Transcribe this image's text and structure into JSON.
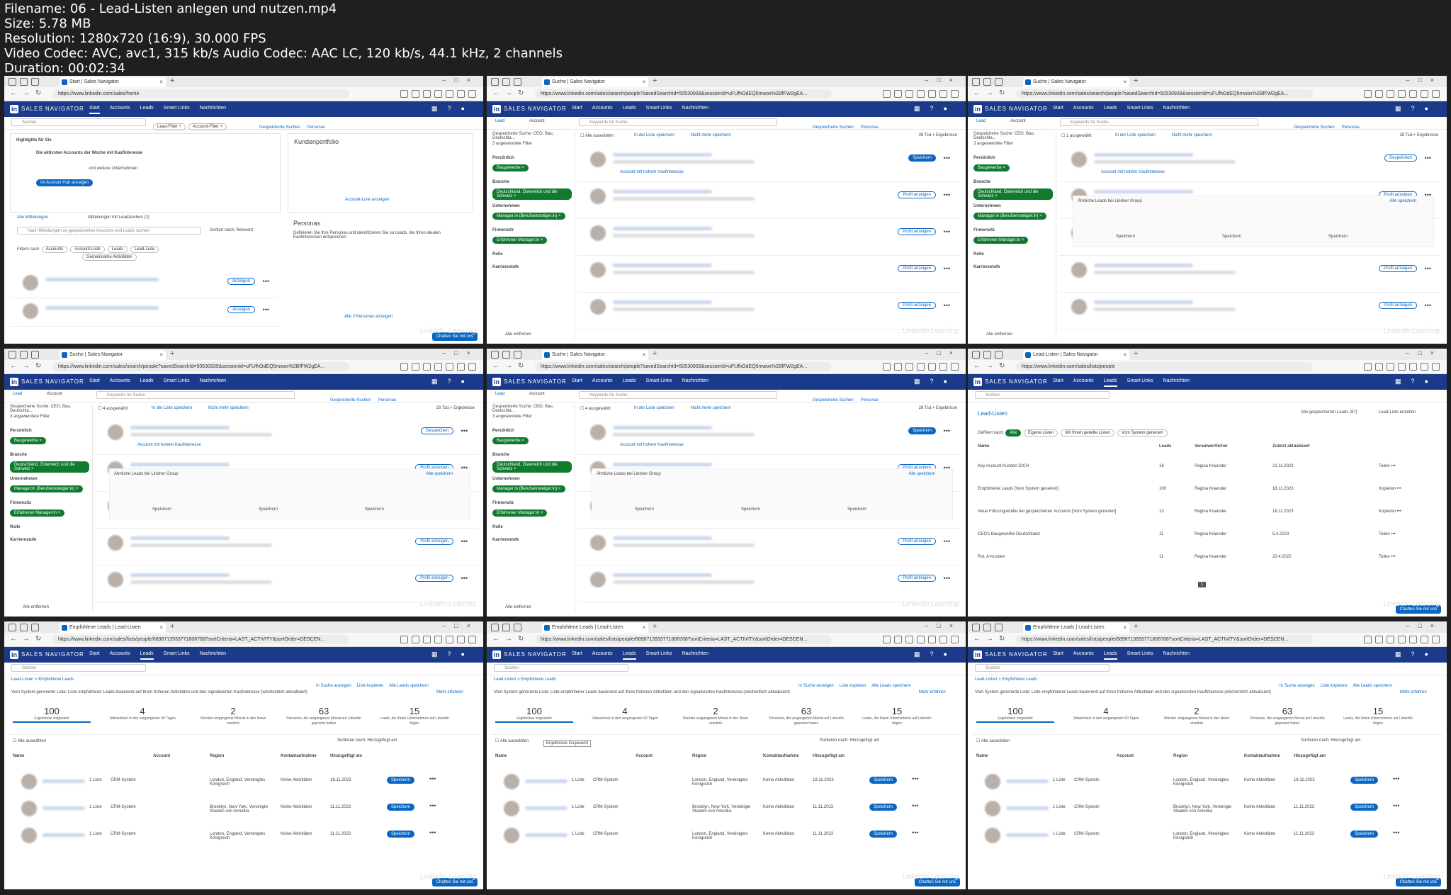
{
  "header": {
    "filename": "Filename: 06 - Lead-Listen anlegen und nutzen.mp4",
    "size": "Size: 5.78 MB",
    "resolution": "Resolution: 1280x720 (16:9), 30.000 FPS",
    "codec": "Video Codec: AVC, avc1, 315 kb/s Audio Codec: AAC LC, 120 kb/s, 44.1 kHz, 2 channels",
    "duration": "Duration: 00:02:34"
  },
  "nav": {
    "brand": "SALES NAVIGATOR",
    "items": [
      "Start",
      "Accounts",
      "Leads",
      "Smart Links",
      "Nachrichten"
    ]
  },
  "tiles": [
    {
      "tab": "Start | Sales Navigator",
      "url": "https://www.linkedin.com/sales/home",
      "active_nav": "Start",
      "kind": "home",
      "search_placeholder": "Suchen",
      "filters": [
        "Lead-Filter +",
        "Account-Filter +"
      ],
      "links": [
        "Gespeicherte Suchen",
        "Personas"
      ],
      "highlights": "Highlights für Sie",
      "highlight_text": "Die aktivsten Accounts der Woche mit Kaufinteresse",
      "highlight_more": "und weitere Unternehmen",
      "hub_button": "Im Account Hub anzeigen",
      "tab_all": "Alle Mitteilungen",
      "tab_leads": "Mitteilungen mit Leadzeichen (2)",
      "search_msgs": "Nach Mitteilungen zu gespeicherten Accounts und Leads suchen",
      "sort": "Sortiert nach: Relevant",
      "filter_by": "Filtern nach:",
      "filter_pills": [
        "Accounts",
        "Account-Liste",
        "Leads",
        "Lead-Liste"
      ],
      "common": "Gemeinsame Aktivitäten",
      "portfolio_title": "Kundenportfolio",
      "portfolio_link": "Account-Liste anzeigen",
      "personas_title": "Personas",
      "personas_text": "Definieren Sie Ihre Personas und identifizieren Sie so Leads, die Ihren idealen Kaufinteressen entsprechen",
      "show": "Anzeigen",
      "all_personas": "Alle 2 Personas anzeigen",
      "chat": "Chatten Sie mit uns"
    },
    {
      "tab": "Suche | Sales Navigator",
      "url": "https://www.linkedin.com/sales/search/people?savedSearchId=50530939&sessionId=uFUfhOdEQ5mwox%2BfFW2gEA...",
      "active_nav": "",
      "kind": "search",
      "saved_search": "Gespeicherte Suche: CEO, Bau, Deutschla...",
      "filters_applied": "3 angewendete Filter",
      "labels": [
        "Persönlich",
        "Branche",
        "Unternehmen",
        "Firmensitz",
        "Rolle",
        "Karrierestufe"
      ],
      "tags": [
        "Baugewerbe",
        "Deutschland, Österreich und die Schweiz",
        "Manager:in (Berufseinsteiger:in)",
        "Erfahrener Manager:in"
      ],
      "keyword_placeholder": "Keywords für Suche",
      "links": [
        "Gespeicherte Suchen",
        "Personas"
      ],
      "select_all": "Alle auswählen",
      "in_list": "In der Liste speichern",
      "no_more": "Nicht mehr speichern",
      "count": "28 Tsd.+ Ergebnisse",
      "save": "Speichern",
      "profile": "Profil anzeigen",
      "account_interest": "Account mit hohem Kaufinteresse",
      "remove_all": "Alle entfernen",
      "tab_lead": "Lead",
      "tab_account": "Account"
    },
    {
      "tab": "Suche | Sales Navigator",
      "url": "https://www.linkedin.com/sales/search/people?savedSearchId=50530939&sessionId=uFUfhOdEQ5mwox%2BfFW2gEA...",
      "active_nav": "",
      "kind": "search",
      "saved_search": "Gespeicherte Suche: CEO, Bau, Deutschla...",
      "selected": "1 ausgewählt",
      "in_list": "In der Liste speichern",
      "no_more": "Nicht mehr speichern",
      "count": "28 Tsd.+ Ergebnisse",
      "saved": "Gespeichert",
      "similar": "Ähnliche Leads bei Lindner Group",
      "all_save": "Alle speichern",
      "save": "Speichern",
      "profile": "Profil anzeigen"
    },
    {
      "tab": "Suche | Sales Navigator",
      "url": "https://www.linkedin.com/sales/search/people?savedSearchId=50530939&sessionId=uFUfhOdEQ5mwox%2BfFW2gEA...",
      "active_nav": "",
      "kind": "search",
      "saved_search": "Gespeicherte Suche: CEO, Bau, Deutschla...",
      "selected": "4 ausgewählt",
      "in_list": "In der Liste speichern",
      "no_more": "Nicht mehr speichern",
      "count": "28 Tsd.+ Ergebnisse",
      "saved": "Gespeichert",
      "similar": "Ähnliche Leads bei Lindner Group",
      "all_save": "Alle speichern",
      "save": "Speichern",
      "profile": "Profil anzeigen"
    },
    {
      "tab": "Suche | Sales Navigator",
      "url": "https://www.linkedin.com/sales/search/people?savedSearchId=50530939&sessionId=uFUfhOdEQ5mwox%2BfFW2gEA...",
      "active_nav": "",
      "kind": "search",
      "saved_search": "Gespeicherte Suche: CEO, Bau, Deutschla...",
      "selected": "4 ausgewählt",
      "in_list": "In der Liste speichern",
      "no_more": "Nicht mehr speichern",
      "count": "28 Tsd.+ Ergebnisse",
      "similar": "Ähnliche Leads bei Lindner Group",
      "all_save": "Alle speichern",
      "save": "Speichern",
      "profile": "Profil anzeigen"
    },
    {
      "tab": "Lead-Listen | Sales Navigator",
      "url": "https://www.linkedin.com/sales/lists/people",
      "active_nav": "Leads",
      "kind": "lists",
      "heading": "Lead-Listen",
      "all_saved": "Alle gespeicherten Leads (87)",
      "create": "Lead-Liste erstellen",
      "filter_label": "Gefiltert nach:",
      "filter_pills": [
        "Alle",
        "Eigene Listen",
        "Mit Ihnen geteilte Listen",
        "Vom System generiert"
      ],
      "columns": [
        "Name",
        "Leads",
        "Verantwortlicher",
        "Zuletzt aktualisiert"
      ],
      "rows": [
        {
          "name": "Key Account Kunden D/CH",
          "leads": "16",
          "owner": "Regina Kraender",
          "date": "21.11.2023",
          "action": "Teilen"
        },
        {
          "name": "Empfohlene Leads",
          "badge": "Vom System generiert",
          "leads": "100",
          "owner": "Regina Kraender",
          "date": "18.11.2023",
          "action": "Kopieren"
        },
        {
          "name": "Neue Führungskräfte bei gespeicherten Accounts",
          "badge": "Vom System generiert",
          "leads": "13",
          "owner": "Regina Kraender",
          "date": "18.11.2023",
          "action": "Kopieren"
        },
        {
          "name": "CEO's Baugewerbe Deutschland",
          "leads": "11",
          "owner": "Regina Kraender",
          "date": "5.4.2023",
          "action": "Teilen"
        },
        {
          "name": "Pot. A-Kunden",
          "leads": "11",
          "owner": "Regina Kraender",
          "date": "20.4.2022",
          "action": "Teilen"
        }
      ],
      "page": "1",
      "chat": "Chatten Sie mit uns"
    },
    {
      "tab": "Empfohlene Leads | Lead-Listen",
      "url": "https://www.linkedin.com/sales/lists/people/6898713933771808768?sortCriteria=LAST_ACTIVITY&sortOrder=DESCEN...",
      "active_nav": "Leads",
      "kind": "recommended",
      "breadcrumb": "Lead-Listen > Empfohlene Leads",
      "actions": [
        "In Suche anzeigen",
        "Liste kopieren",
        "Alle Leads speichern"
      ],
      "sys_note": "Vom System generierte Liste: Liste empfohlener Leads basierend auf Ihren früheren Aktivitäten und den signalisierten Kaufinteresse (wöchentlich aktualisiert)",
      "more": "Mehr erfahren",
      "stats": [
        {
          "n": "100",
          "l": "Ergebnisse insgesamt"
        },
        {
          "n": "4",
          "l": "Jobwechsel in den vergangenen 90 Tagen"
        },
        {
          "n": "2",
          "l": "Wurden vergangenen Monat in den News erwähnt"
        },
        {
          "n": "63",
          "l": "Personen, die vergangenen Monat auf LinkedIn gepostet haben"
        },
        {
          "n": "15",
          "l": "Leads, die Ihrem Unternehmen auf LinkedIn folgen"
        }
      ],
      "select_all": "Alle auswählen",
      "sort": "Sortieren nach: Hinzugefügt am",
      "columns": [
        "Name",
        "Account",
        "Region",
        "Kontaktaufnahme",
        "Hinzugefügt am"
      ],
      "rows": [
        {
          "list": "1 Liste",
          "crm": "CRM-System",
          "region": "London, England, Vereinigtes Königreich",
          "contact": "Keine Aktivitäten",
          "date": "18.11.2023"
        },
        {
          "list": "1 Liste",
          "crm": "CRM-System",
          "region": "Brooklyn, New York, Vereinigte Staaten von Amerika",
          "contact": "Keine Aktivitäten",
          "date": "11.11.2023"
        },
        {
          "list": "1 Liste",
          "crm": "CRM-System",
          "region": "London, England, Vereinigtes Königreich",
          "contact": "Keine Aktivitäten",
          "date": "11.11.2023"
        }
      ],
      "save": "Speichern",
      "chat": "Chatten Sie mit uns"
    },
    {
      "tab": "Empfohlene Leads | Lead-Listen",
      "url": "https://www.linkedin.com/sales/lists/people/6898713933771808768?sortCriteria=LAST_ACTIVITY&sortOrder=DESCEN...",
      "active_nav": "Leads",
      "kind": "recommended",
      "tooltip": "Ergebnisse insgesamt"
    },
    {
      "tab": "Empfohlene Leads | Lead-Listen",
      "url": "https://www.linkedin.com/sales/lists/people/6898713933771808768?sortCriteria=LAST_ACTIVITY&sortOrder=DESCEN...",
      "active_nav": "Leads",
      "kind": "recommended"
    }
  ],
  "watermark": "LinkedIn Learning"
}
